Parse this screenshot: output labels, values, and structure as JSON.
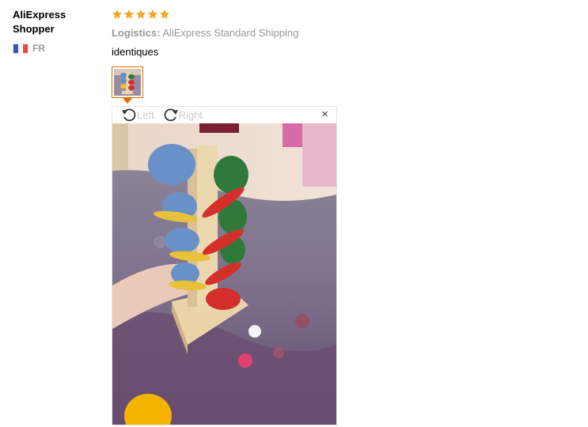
{
  "reviewer": {
    "name_line1": "AliExpress",
    "name_line2": "Shopper",
    "country_code": "FR",
    "flag_colors": [
      "#3b53b3",
      "#ffffff",
      "#e84a4a"
    ]
  },
  "rating": {
    "stars": 5,
    "max": 5,
    "color": "#f5a623"
  },
  "logistics": {
    "label": "Logistics:",
    "value": "AliExpress Standard Shipping"
  },
  "comment": "identiques",
  "viewer": {
    "rotate_left_label": "Left",
    "rotate_right_label": "Right",
    "close_glyph": "×",
    "photo_description_icon": "photo-image"
  },
  "colors": {
    "accent": "#e66a00",
    "muted": "#999999"
  }
}
